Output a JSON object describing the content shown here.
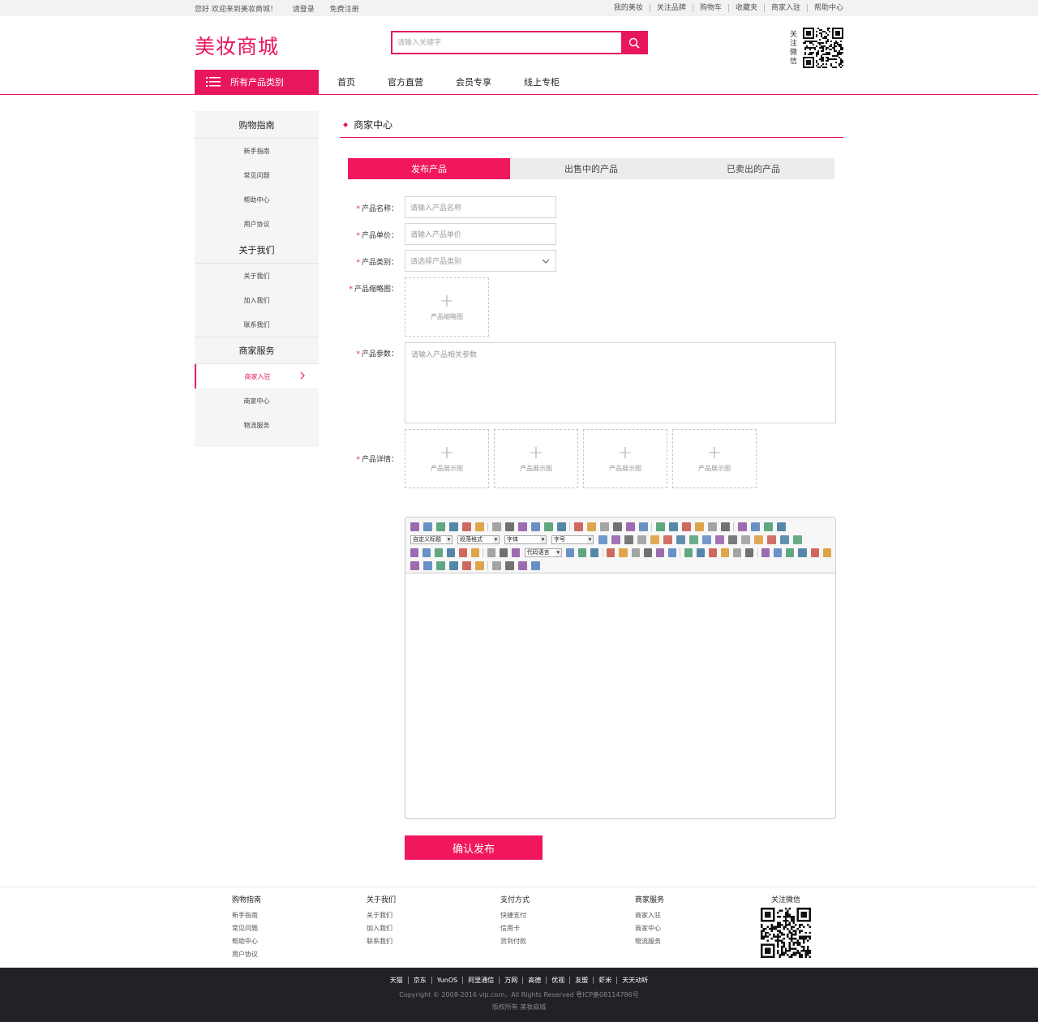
{
  "topbar": {
    "welcome": "您好 欢迎来到美妆商城！",
    "login": "请登录",
    "register": "免费注册",
    "links": [
      "我的美妆",
      "关注品牌",
      "购物车",
      "收藏夹",
      "商家入驻",
      "帮助中心"
    ]
  },
  "header": {
    "logo": "美妆商城",
    "search_placeholder": "请输入关键字",
    "wechat_label": "关注微信",
    "wechat_chars": [
      "关",
      "注",
      "微",
      "信"
    ]
  },
  "nav": {
    "all_categories": "所有产品类别",
    "links": [
      "首页",
      "官方直营",
      "会员专享",
      "线上专柜"
    ]
  },
  "sidebar": {
    "groups": [
      {
        "title": "购物指南",
        "items": [
          "新手指南",
          "常见问题",
          "帮助中心",
          "用户协议"
        ]
      },
      {
        "title": "关于我们",
        "items": [
          "关于我们",
          "加入我们",
          "联系我们"
        ]
      },
      {
        "title": "商家服务",
        "items": [
          "商家入驻",
          "商家中心",
          "物流服务"
        ]
      }
    ],
    "active_item": "商家入驻"
  },
  "content": {
    "title": "商家中心",
    "tabs": [
      "发布产品",
      "出售中的产品",
      "已卖出的产品"
    ],
    "active_tab": "发布产品"
  },
  "form": {
    "name": {
      "label": "产品名称：",
      "placeholder": "请输入产品名称"
    },
    "price": {
      "label": "产品单价：",
      "placeholder": "请输入产品单价"
    },
    "category": {
      "label": "产品类别：",
      "placeholder": "请选择产品类别"
    },
    "thumbnail": {
      "label": "产品缩略图：",
      "upload_text": "产品缩略图"
    },
    "params": {
      "label": "产品参数：",
      "placeholder": "请输入产品相关参数"
    },
    "details": {
      "label": "产品详情：",
      "upload_text": "产品展示图"
    },
    "editor": {
      "selects": [
        "自定义标题",
        "段落格式",
        "字体",
        "字号",
        "代码语言"
      ]
    },
    "submit": "确认发布"
  },
  "footer": {
    "columns": [
      {
        "title": "购物指南",
        "items": [
          "新手指南",
          "常见问题",
          "帮助中心",
          "用户协议"
        ]
      },
      {
        "title": "关于我们",
        "items": [
          "关于我们",
          "加入我们",
          "联系我们"
        ]
      },
      {
        "title": "支付方式",
        "items": [
          "快捷支付",
          "信用卡",
          "货到付款"
        ]
      },
      {
        "title": "商家服务",
        "items": [
          "商家入驻",
          "商家中心",
          "物流服务"
        ]
      }
    ],
    "wechat_title": "关注微信",
    "bottom_links": [
      "天猫",
      "京东",
      "YunOS",
      "阿里通信",
      "万网",
      "高德",
      "优视",
      "友盟",
      "虾米",
      "天天动听"
    ],
    "copyright": "Copyright © 2008-2016 vip.com，All Rights Reserved 粤ICP备08114786号",
    "rights": "版权所有  美妆商城"
  },
  "colors": {
    "brand": "#e8175d",
    "footer_bg": "#212226",
    "sidebar_bg": "#f5f5f5"
  }
}
